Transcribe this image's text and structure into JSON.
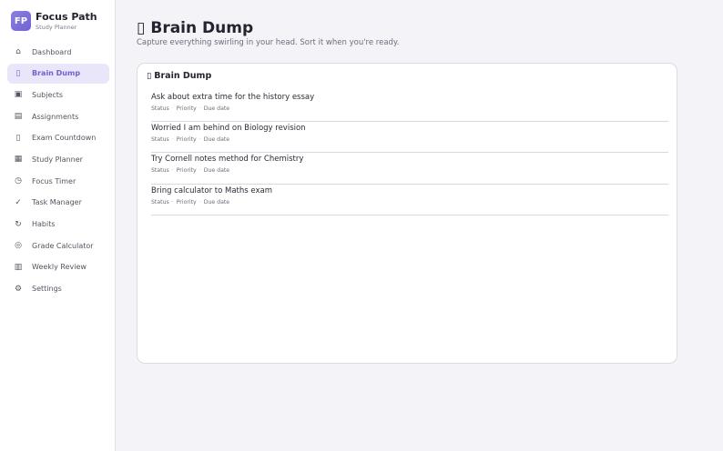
{
  "brand": {
    "logo": "FP",
    "name": "Focus Path",
    "subtitle": "Study Planner"
  },
  "colors": {
    "accent": "#6f63d3",
    "accent_bg": "#e8e6f8",
    "page_bg": "#f4f3f8"
  },
  "sidebar": {
    "items": [
      {
        "icon": "⌂",
        "icon_name": "home-icon",
        "label": "Dashboard",
        "active": false
      },
      {
        "icon": "▯",
        "icon_name": "brain-icon",
        "label": "Brain Dump",
        "active": true
      },
      {
        "icon": "▣",
        "icon_name": "book-icon",
        "label": "Subjects",
        "active": false
      },
      {
        "icon": "▤",
        "icon_name": "clipboard-icon",
        "label": "Assignments",
        "active": false
      },
      {
        "icon": "▯",
        "icon_name": "hourglass-icon",
        "label": "Exam Countdown",
        "active": false
      },
      {
        "icon": "▦",
        "icon_name": "calendar-icon",
        "label": "Study Planner",
        "active": false
      },
      {
        "icon": "◷",
        "icon_name": "clock-icon",
        "label": "Focus Timer",
        "active": false
      },
      {
        "icon": "✓",
        "icon_name": "check-icon",
        "label": "Task Manager",
        "active": false
      },
      {
        "icon": "↻",
        "icon_name": "refresh-icon",
        "label": "Habits",
        "active": false
      },
      {
        "icon": "◎",
        "icon_name": "target-icon",
        "label": "Grade Calculator",
        "active": false
      },
      {
        "icon": "▥",
        "icon_name": "chart-icon",
        "label": "Weekly Review",
        "active": false
      },
      {
        "icon": "⚙",
        "icon_name": "gear-icon",
        "label": "Settings",
        "active": false
      }
    ]
  },
  "page": {
    "title_icon": "▯",
    "title": "Brain Dump",
    "subtitle": "Capture everything swirling in your head. Sort it when you're ready."
  },
  "card": {
    "title_icon": "▯",
    "title": "Brain Dump",
    "entries": [
      {
        "text": "Ask about extra time for the history essay",
        "status": "Status",
        "priority": "Priority",
        "due": "Due date"
      },
      {
        "text": "Worried I am behind on Biology revision",
        "status": "Status",
        "priority": "Priority",
        "due": "Due date"
      },
      {
        "text": "Try Cornell notes method for Chemistry",
        "status": "Status",
        "priority": "Priority",
        "due": "Due date"
      },
      {
        "text": "Bring calculator to Maths exam",
        "status": "Status",
        "priority": "Priority",
        "due": "Due date"
      }
    ],
    "separator": "·"
  }
}
